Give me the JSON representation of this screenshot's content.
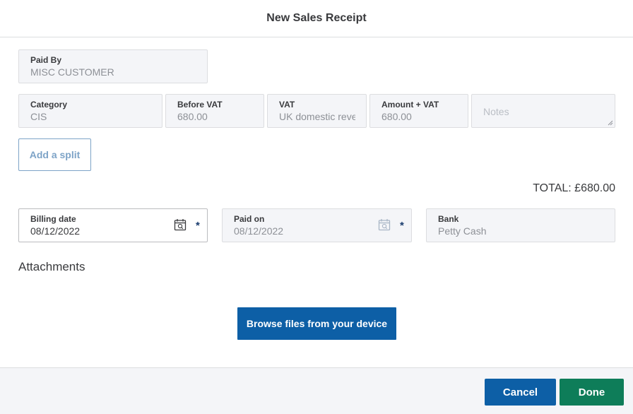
{
  "header": {
    "title": "New Sales Receipt"
  },
  "paid_by": {
    "label": "Paid By",
    "value": "MISC CUSTOMER"
  },
  "line": {
    "category": {
      "label": "Category",
      "value": "CIS"
    },
    "before_vat": {
      "label": "Before VAT",
      "value": "680.00"
    },
    "vat": {
      "label": "VAT",
      "value": "UK domestic reve"
    },
    "amount_vat": {
      "label": "Amount + VAT",
      "value": "680.00"
    },
    "notes": {
      "placeholder": "Notes"
    }
  },
  "split_label": "Add a split",
  "total": "TOTAL: £680.00",
  "billing_date": {
    "label": "Billing date",
    "value": "08/12/2022",
    "required": "*"
  },
  "paid_on": {
    "label": "Paid on",
    "value": "08/12/2022",
    "required": "*"
  },
  "bank": {
    "label": "Bank",
    "value": "Petty Cash"
  },
  "attachments": {
    "title": "Attachments",
    "browse_label": "Browse files from your device"
  },
  "footer": {
    "cancel_label": "Cancel",
    "done_label": "Done"
  },
  "icons": {
    "calendar": "calendar-icon"
  },
  "colors": {
    "primary": "#0d5fa6",
    "success": "#0e7d59",
    "text": "#393a3d",
    "muted": "#8d9096",
    "link": "#7da3c7"
  }
}
